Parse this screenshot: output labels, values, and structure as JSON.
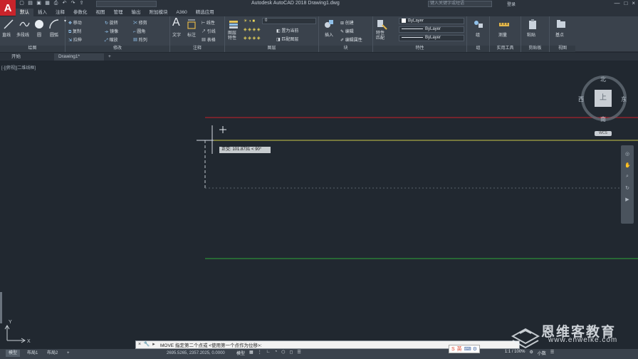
{
  "title_bar": {
    "app_letter": "A",
    "workspace": "",
    "app_title": "Autodesk AutoCAD 2018    Drawing1.dwg",
    "search_placeholder": "键入关键字或短语",
    "login_label": "登录",
    "window_controls": [
      "—",
      "□",
      "×"
    ]
  },
  "ribbon_tabs": [
    {
      "label": "默认",
      "active": true
    },
    {
      "label": "插入",
      "active": false
    },
    {
      "label": "注释",
      "active": false
    },
    {
      "label": "参数化",
      "active": false
    },
    {
      "label": "视图",
      "active": false
    },
    {
      "label": "管理",
      "active": false
    },
    {
      "label": "输出",
      "active": false
    },
    {
      "label": "附加模块",
      "active": false
    },
    {
      "label": "A360",
      "active": false
    },
    {
      "label": "精选应用",
      "active": false
    }
  ],
  "ribbon": {
    "draw": {
      "title": "绘图",
      "line": "直线",
      "polyline": "多段线",
      "circle": "圆",
      "arc": "圆弧"
    },
    "modify": {
      "title": "修改",
      "items": [
        "移动",
        "旋转",
        "修剪",
        "复制",
        "镜像",
        "圆角",
        "拉伸",
        "缩放",
        "阵列"
      ]
    },
    "annotation": {
      "title": "注释",
      "text": "文字",
      "dimension": "标注",
      "items": [
        "线性",
        "引线",
        "表格"
      ]
    },
    "layers": {
      "title": "图层",
      "layer_properties": "图层\n特性",
      "current_layer": "0",
      "items": [
        "置为当前",
        "匹配图层"
      ]
    },
    "block": {
      "title": "块",
      "insert": "插入",
      "items": [
        "创建",
        "编辑",
        "编辑属性"
      ]
    },
    "properties": {
      "title": "特性",
      "match": "特性\n匹配",
      "color": "ByLayer",
      "linetype": "ByLayer",
      "lineweight": "ByLayer"
    },
    "groups": {
      "title": "组",
      "label": "组"
    },
    "utilities": {
      "title": "实用工具",
      "label": "测量"
    },
    "clipboard": {
      "title": "剪贴板",
      "label": "粘贴"
    },
    "view": {
      "title": "视图",
      "label": "基点"
    }
  },
  "file_tabs": [
    {
      "label": "开始",
      "active": false
    },
    {
      "label": "Drawing1*",
      "active": true
    }
  ],
  "file_tab_add": "+",
  "viewport_label": "[-][俯视][二维线框]",
  "viewcube": {
    "north": "北",
    "south": "南",
    "east": "东",
    "west": "西",
    "top": "上",
    "wcs": "WCS"
  },
  "tooltip_input": "正交: 101.8731 < 90°",
  "colors": {
    "red_line": "#c8202a",
    "yellow_line": "#c9c94a",
    "green_line": "#2fa83a",
    "canvas_bg": "#212830"
  },
  "command_line": {
    "close_icon": "×",
    "text": "MOVE 指定第二个点或 <使用第一个点作为位移>:"
  },
  "layout_tabs": [
    {
      "label": "模型",
      "active": true
    },
    {
      "label": "布局1",
      "active": false
    },
    {
      "label": "布局2",
      "active": false
    }
  ],
  "layout_add": "+",
  "coordinates": "2695.5265, 2357.2025, 0.0000",
  "status": {
    "model": "模型",
    "scale": "1:1 / 100%",
    "decimal": "小数"
  },
  "ime": {
    "label": "英"
  },
  "watermark": {
    "text": "恩维客教育",
    "url": "www.enweike.com"
  }
}
